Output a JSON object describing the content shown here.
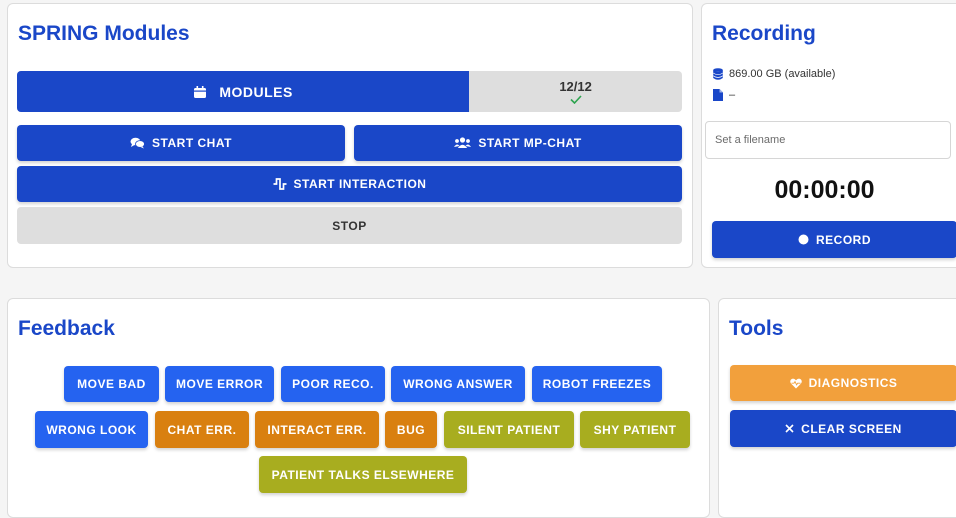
{
  "modules": {
    "title": "SPRING Modules",
    "bar_label": "MODULES",
    "count": "12/12",
    "progress": 0.68,
    "start_chat": "START CHAT",
    "start_mp_chat": "START MP-CHAT",
    "start_interaction": "START INTERACTION",
    "stop": "STOP"
  },
  "recording": {
    "title": "Recording",
    "disk": "869.00 GB (available)",
    "file": "–",
    "filename_placeholder": "Set a filename",
    "timer": "00:00:00",
    "record": "RECORD"
  },
  "feedback": {
    "title": "Feedback",
    "buttons": [
      "MOVE BAD",
      "MOVE ERROR",
      "POOR RECO.",
      "WRONG ANSWER",
      "ROBOT FREEZES",
      "WRONG LOOK",
      "CHAT ERR.",
      "INTERACT ERR.",
      "BUG",
      "SILENT PATIENT",
      "SHY PATIENT",
      "PATIENT TALKS ELSEWHERE"
    ]
  },
  "tools": {
    "title": "Tools",
    "diagnostics": "DIAGNOSTICS",
    "clear_screen": "CLEAR SCREEN"
  },
  "icons": {
    "modules": "calendar-icon",
    "chat": "comments-icon",
    "mp_chat": "users-icon",
    "interaction": "wave-square-icon",
    "check": "check-icon",
    "disk": "database-icon",
    "file": "file-icon",
    "record": "circle-icon",
    "diagnostics": "heart-pulse-icon",
    "clear": "x-icon"
  },
  "colors": {
    "primary": "#1a47c8",
    "feedback_blue": "#2563f0",
    "feedback_orange": "#d98010",
    "feedback_olive": "#a8ad1f",
    "diagnostics": "#f2a03c",
    "success": "#2ea44f"
  }
}
